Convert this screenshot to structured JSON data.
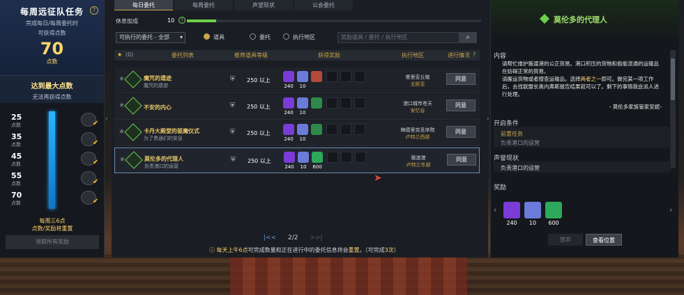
{
  "left": {
    "title": "每周远征队任务",
    "help": "?",
    "desc1": "完成每日/每周委托时",
    "desc2": "可获得点数",
    "points": "70",
    "points_unit": "点数",
    "max_title": "达到最大点数",
    "max_sub": "无法再获得点数",
    "tiers": [
      {
        "value": "25",
        "unit": "点数"
      },
      {
        "value": "35",
        "unit": "点数"
      },
      {
        "value": "45",
        "unit": "点数"
      },
      {
        "value": "55",
        "unit": "点数"
      },
      {
        "value": "70",
        "unit": "点数"
      }
    ],
    "reset1": "每周三6点",
    "reset2": "点数/奖励将重置",
    "claim_btn": "领取所有奖励"
  },
  "main": {
    "tabs": [
      "每日委托",
      "每周委托",
      "声望现状",
      "公会委托"
    ],
    "rest_label": "休息加成",
    "rest_value": "10",
    "rest_help": "?",
    "rest_progress": 0.1,
    "filter_value": "可执行的委托 - 全部",
    "radios": [
      "道具",
      "委托",
      "执行地区"
    ],
    "search_placeholder": "奖励道具 / 委托 / 执行地区",
    "header": {
      "fav_count": "(0)",
      "list": "委托列表",
      "level": "推荐道具等级",
      "reward": "获得奖励",
      "region": "执行地区",
      "status": "进行情况",
      "status_help": "?"
    },
    "rows": [
      {
        "name": "魔咒的遗迹",
        "sub": "魔咒的遗迹",
        "level": "250 以上",
        "r1": "240",
        "r2": "10",
        "r3": "",
        "region1": "墨里亚丘陵",
        "region2": "尤肤亚",
        "btn": "同意"
      },
      {
        "name": "不安的内心",
        "sub": "",
        "level": "250 以上",
        "r1": "240",
        "r2": "10",
        "r3": "",
        "region1": "港口城市苍天",
        "region2": "安忆谷",
        "btn": "同意"
      },
      {
        "name": "卡丹大殿堂的驱魔仪式",
        "sub": "为了贵通们的安息",
        "level": "250 以上",
        "r1": "240",
        "r2": "10",
        "r3": "",
        "region1": "梅德里克圣序院",
        "region2": "卢特兰西部",
        "btn": "同意"
      },
      {
        "name": "莫伦多的代理人",
        "sub": "负责港口的运营",
        "level": "250 以上",
        "r1": "240",
        "r2": "10",
        "r3": "600",
        "region1": "贩渡港",
        "region2": "卢特兰东部",
        "btn": "同意"
      }
    ],
    "pager": "2/2",
    "note_a": "每天上午6点",
    "note_b": "可完成数量和正在进行中的委托信息将会",
    "note_c": "重置",
    "note_d": "。（可完成",
    "note_e": "3次",
    "note_f": "）"
  },
  "right": {
    "title": "莫伦多的代理人",
    "content_label": "内容",
    "content_1": "请帮忙维护贩渡港的公正贸易。港口积压的货物和偷偷流通的运输品在妨碍正常的贸易。",
    "content_2a": "请搬运货物或者搜查运输品。选择",
    "content_2b": "两者之一",
    "content_2c": "即可。做完某一项工作后，去找联盟长奥内弗斯报告结果就可以了。剩下的事情我会派人进行处理。",
    "signature": "- 莫伦多家族管家安妮-",
    "cond_label": "开启条件",
    "cond_sub1": "前置任务",
    "cond_sub2": "负责港口的运营",
    "rep_label": "声誉现状",
    "rep_value": "负责港口的运营",
    "reward_label": "奖励",
    "rewards": [
      "240",
      "10",
      "600"
    ],
    "abandon_btn": "放弃",
    "locate_btn": "查看位置"
  },
  "colors": {
    "accent_gold": "#caa54a",
    "green": "#6fd04a",
    "blue_bar": "#28b6ff"
  }
}
